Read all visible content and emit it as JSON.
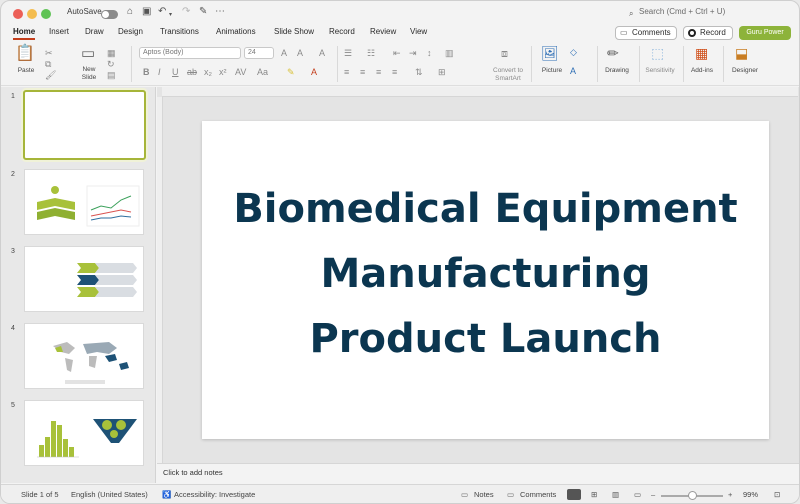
{
  "titlebar": {
    "autosave_label": "AutoSave",
    "search_placeholder": "Search (Cmd + Ctrl + U)"
  },
  "tabs": [
    "Home",
    "Insert",
    "Draw",
    "Design",
    "Transitions",
    "Animations",
    "Slide Show",
    "Record",
    "Review",
    "View"
  ],
  "top_buttons": {
    "comments": "Comments",
    "record": "Record",
    "guru": "Guru Power"
  },
  "ribbon": {
    "paste": "Paste",
    "new_slide": "New Slide",
    "font_name": "Aptos (Body)",
    "font_size": "24",
    "convert_to_smartart": "Convert to SmartArt",
    "picture": "Picture",
    "drawing": "Drawing",
    "sensitivity": "Sensitivity",
    "add_ins": "Add-ins",
    "designer": "Designer"
  },
  "slides": [
    {
      "number": "1"
    },
    {
      "number": "2"
    },
    {
      "number": "3"
    },
    {
      "number": "4"
    },
    {
      "number": "5"
    }
  ],
  "slide_title_lines": [
    "Biomedical Equipment",
    "Manufacturing",
    "Product Launch"
  ],
  "notes_placeholder": "Click to add notes",
  "status": {
    "slide_counter": "Slide 1 of 5",
    "language": "English (United States)",
    "accessibility": "Accessibility: Investigate",
    "notes": "Notes",
    "comments": "Comments",
    "zoom": "99%"
  },
  "colors": {
    "title": "#0b3650",
    "accent": "#8db33a",
    "tab_underline": "#c43e1c"
  }
}
